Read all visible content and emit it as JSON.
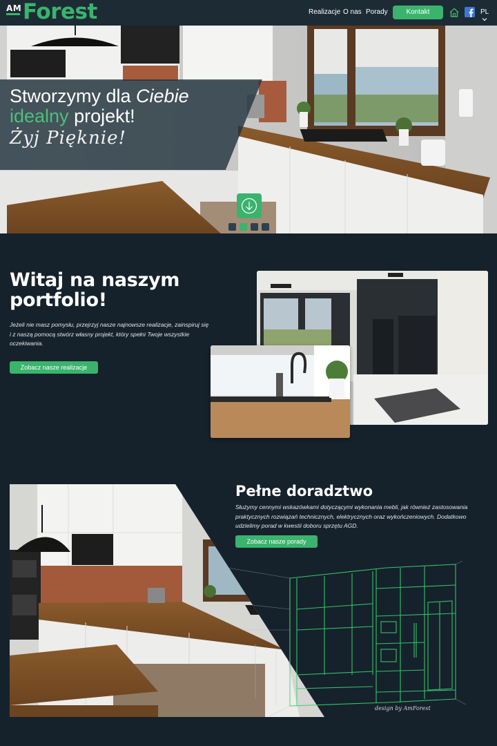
{
  "nav": {
    "logo_am": "AM",
    "logo_forest": "Forest",
    "links": [
      "Realizacje",
      "O nas",
      "Porady"
    ],
    "cta": "Kontakt",
    "lang": "PL",
    "icons": [
      "home-icon",
      "facebook-icon",
      "chevron-down-icon"
    ]
  },
  "hero": {
    "title_line1_a": "Stworzymy dla ",
    "title_line1_b": "Ciebie",
    "title_line2_a": "idealny",
    "title_line2_b": " projekt!",
    "script": "Żyj Pięknie!",
    "slider": {
      "count": 4,
      "active": 1
    },
    "icons": [
      "arrow-down-circle-icon"
    ]
  },
  "portfolio": {
    "title_line1": "Witaj na naszym",
    "title_line2": "portfolio!",
    "text": "Jeżeli nie masz pomysłu, przejrzyj nasze najnowsze realizacje, zainspiruj się i z naszą pomocą stwórz własny projekt, który spełni Twoje wszystkie oczekiwania.",
    "button": "Zobacz nasze realizacje"
  },
  "advice": {
    "title": "Pełne doradztwo",
    "text": "Służymy cennymi wskazówkami dotyczącymi wykonania mebli, jak również zastosowania praktycznych rozwiązań technicznych, elektrycznych oraz wykończeniowych. Dodatkowo udzielimy porad w kwestii doboru sprzętu AGD.",
    "button": "Zobacz nasze porady",
    "signature": "design by AmForest"
  },
  "colors": {
    "accent": "#3ab36d",
    "background": "#15222c",
    "navbar": "#1d2b35"
  }
}
